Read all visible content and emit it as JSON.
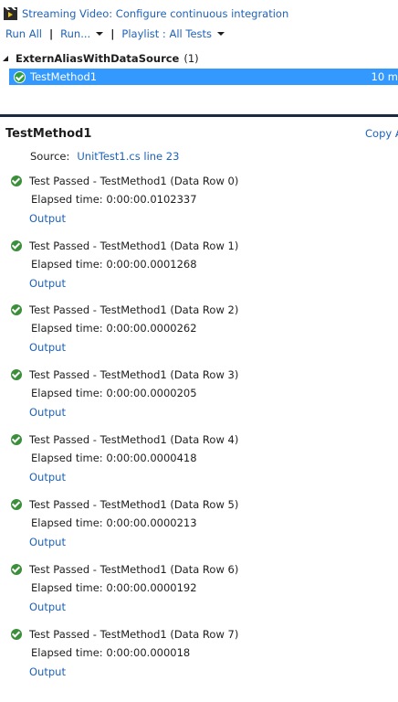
{
  "top": {
    "video_link": "Streaming Video: Configure continuous integration",
    "toolbar": {
      "run_all": "Run All",
      "run": "Run...",
      "playlist": "Playlist : All Tests"
    },
    "group": {
      "name": "ExternAliasWithDataSource",
      "count": "(1)"
    },
    "selected_test": {
      "name": "TestMethod1",
      "duration": "10 m"
    }
  },
  "detail": {
    "title": "TestMethod1",
    "copy_all": "Copy A",
    "source_label": "Source:",
    "source_link": "UnitTest1.cs line 23",
    "results": [
      {
        "status": "Test Passed - TestMethod1 (Data Row 0)",
        "elapsed": "Elapsed time: 0:00:00.0102337",
        "output": "Output"
      },
      {
        "status": "Test Passed - TestMethod1 (Data Row 1)",
        "elapsed": "Elapsed time: 0:00:00.0001268",
        "output": "Output"
      },
      {
        "status": "Test Passed - TestMethod1 (Data Row 2)",
        "elapsed": "Elapsed time: 0:00:00.0000262",
        "output": "Output"
      },
      {
        "status": "Test Passed - TestMethod1 (Data Row 3)",
        "elapsed": "Elapsed time: 0:00:00.0000205",
        "output": "Output"
      },
      {
        "status": "Test Passed - TestMethod1 (Data Row 4)",
        "elapsed": "Elapsed time: 0:00:00.0000418",
        "output": "Output"
      },
      {
        "status": "Test Passed - TestMethod1 (Data Row 5)",
        "elapsed": "Elapsed time: 0:00:00.0000213",
        "output": "Output"
      },
      {
        "status": "Test Passed - TestMethod1 (Data Row 6)",
        "elapsed": "Elapsed time: 0:00:00.0000192",
        "output": "Output"
      },
      {
        "status": "Test Passed - TestMethod1 (Data Row 7)",
        "elapsed": "Elapsed time: 0:00:00.000018",
        "output": "Output"
      }
    ]
  },
  "colors": {
    "link": "#1e63b8",
    "selection": "#3399ff",
    "pass": "#3b8f3b",
    "splitter": "#1b2a3f"
  },
  "icons": {
    "video": "video-clapper-icon",
    "pass": "check-circle-icon",
    "dropdown": "caret-down-icon",
    "collapse": "collapse-triangle-icon"
  }
}
